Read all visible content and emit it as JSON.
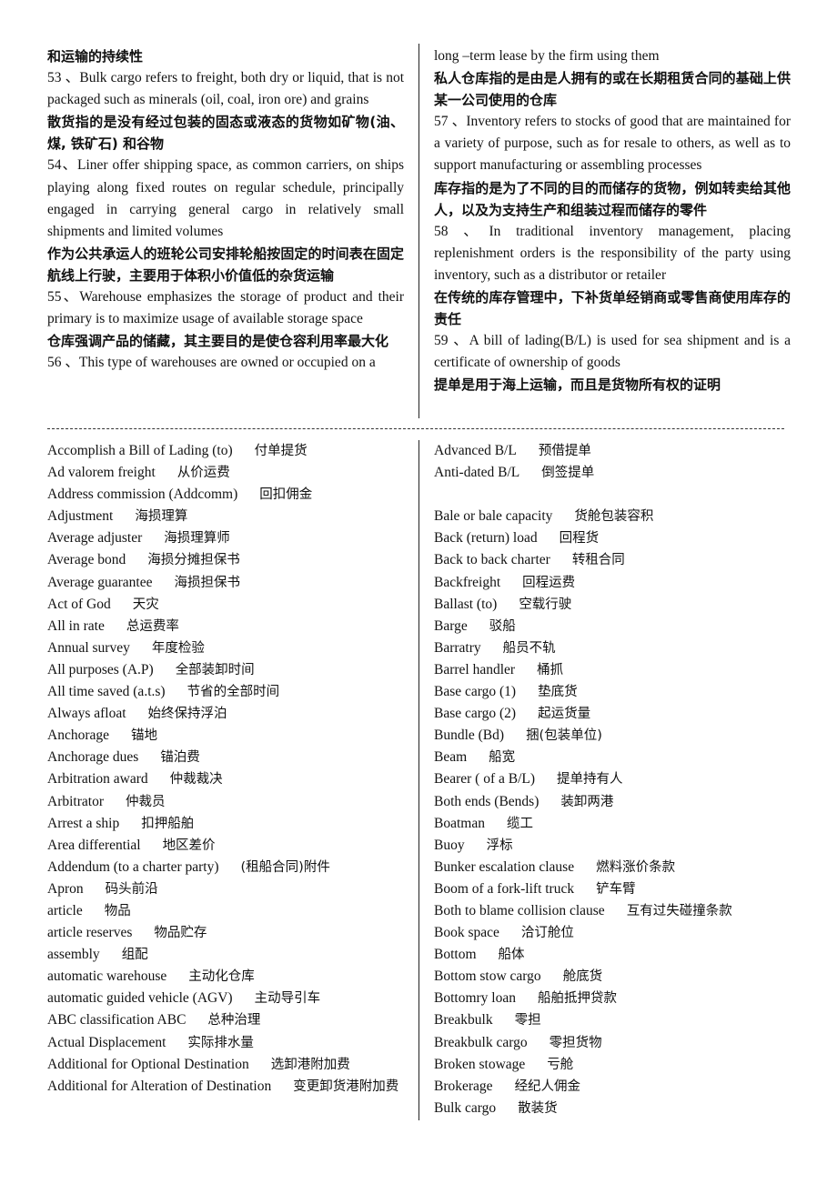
{
  "top_left": [
    {
      "lang": "cn",
      "text": "和运输的持续性"
    },
    {
      "lang": "en",
      "text": "53 、Bulk cargo refers to freight, both dry or liquid, that is not packaged such as minerals (oil, coal, iron ore) and grains"
    },
    {
      "lang": "cn",
      "text": "散货指的是没有经过包装的固态或液态的货物如矿物(油、煤, 铁矿石) 和谷物"
    },
    {
      "lang": "en",
      "text": "54、Liner offer shipping space, as common carriers, on ships playing along fixed routes on regular schedule, principally engaged in carrying general cargo in relatively small shipments and limited volumes"
    },
    {
      "lang": "cn",
      "text": "作为公共承运人的班轮公司安排轮船按固定的时间表在固定航线上行驶，主要用于体积小价值低的杂货运输"
    },
    {
      "lang": "en",
      "text": "55、Warehouse emphasizes the storage of product and their primary is to maximize usage of available storage space"
    },
    {
      "lang": "cn",
      "text": "仓库强调产品的储藏，其主要目的是使仓容利用率最大化"
    },
    {
      "lang": "en",
      "text": "56 、This type of warehouses are owned or occupied on a"
    }
  ],
  "top_right": [
    {
      "lang": "en",
      "text": "long –term lease by the firm using them"
    },
    {
      "lang": "cn",
      "text": "私人仓库指的是由是人拥有的或在长期租赁合同的基础上供某一公司使用的仓库"
    },
    {
      "lang": "en",
      "text": "57 、Inventory refers to stocks of good that are maintained for a variety of purpose, such as for resale to others, as well as to support manufacturing or assembling processes"
    },
    {
      "lang": "cn",
      "text": "库存指的是为了不同的目的而储存的货物，例如转卖给其他人，以及为支持生产和组装过程而储存的零件"
    },
    {
      "lang": "en",
      "text": "58 、In traditional inventory management, placing replenishment orders is the responsibility of the party using inventory, such as a distributor or retailer"
    },
    {
      "lang": "cn",
      "text": "在传统的库存管理中，下补货单经销商或零售商使用库存的责任"
    },
    {
      "lang": "en",
      "text": "59 、A bill of lading(B/L) is used for sea shipment and is a certificate of ownership of goods"
    },
    {
      "lang": "cn",
      "text": "提单是用于海上运输，而且是货物所有权的证明"
    }
  ],
  "glossary_left": [
    {
      "term": "Accomplish a Bill of Lading (to)",
      "zh": "付单提货"
    },
    {
      "term": "Ad valorem freight",
      "zh": "从价运费"
    },
    {
      "term": "Address commission (Addcomm)",
      "zh": "回扣佣金"
    },
    {
      "term": "Adjustment",
      "zh": "海损理算"
    },
    {
      "term": "Average adjuster",
      "zh": "海损理算师"
    },
    {
      "term": "Average bond",
      "zh": "海损分摊担保书"
    },
    {
      "term": "Average guarantee",
      "zh": "海损担保书"
    },
    {
      "term": "Act of God",
      "zh": "天灾"
    },
    {
      "term": "All in rate",
      "zh": "总运费率"
    },
    {
      "term": "Annual survey",
      "zh": "年度检验"
    },
    {
      "term": "All purposes (A.P)",
      "zh": "全部装卸时间"
    },
    {
      "term": "All time saved (a.t.s)",
      "zh": "节省的全部时间"
    },
    {
      "term": "Always afloat",
      "zh": "始终保持浮泊"
    },
    {
      "term": "Anchorage",
      "zh": "锚地"
    },
    {
      "term": "Anchorage dues",
      "zh": "锚泊费"
    },
    {
      "term": "Arbitration award",
      "zh": "仲裁裁决"
    },
    {
      "term": "Arbitrator",
      "zh": "仲裁员"
    },
    {
      "term": "Arrest a ship",
      "zh": "扣押船舶"
    },
    {
      "term": "Area differential",
      "zh": "地区差价"
    },
    {
      "term": "Addendum (to a charter party)",
      "zh": "(租船合同)附件"
    },
    {
      "term": "Apron",
      "zh": "码头前沿"
    },
    {
      "term": "article",
      "zh": "物品"
    },
    {
      "term": "article reserves",
      "zh": "物品贮存"
    },
    {
      "term": "assembly",
      "zh": "组配"
    },
    {
      "term": "automatic warehouse",
      "zh": "主动化仓库"
    },
    {
      "term": "automatic guided vehicle (AGV)",
      "zh": "主动导引车"
    },
    {
      "term": "ABC classification ABC",
      "zh": "总种治理"
    },
    {
      "term": "Actual Displacement",
      "zh": "实际排水量"
    },
    {
      "term": "Additional for Optional Destination",
      "zh": "选卸港附加费"
    },
    {
      "term": "Additional for Alteration of Destination",
      "zh": "变更卸货港附加费",
      "wrap": true
    }
  ],
  "glossary_right": [
    {
      "term": "Advanced B/L",
      "zh": "预借提单"
    },
    {
      "term": "Anti-dated B/L",
      "zh": "倒签提单"
    },
    {
      "term": "",
      "zh": ""
    },
    {
      "term": "Bale or bale capacity",
      "zh": "货舱包装容积"
    },
    {
      "term": "Back (return) load",
      "zh": "回程货"
    },
    {
      "term": "Back to back charter",
      "zh": "转租合同"
    },
    {
      "term": "Backfreight",
      "zh": "回程运费"
    },
    {
      "term": "Ballast (to)",
      "zh": "空载行驶"
    },
    {
      "term": "Barge",
      "zh": "驳船"
    },
    {
      "term": "Barratry",
      "zh": "船员不轨"
    },
    {
      "term": "Barrel handler",
      "zh": "桶抓"
    },
    {
      "term": "Base cargo (1)",
      "zh": "垫底货"
    },
    {
      "term": "Base cargo (2)",
      "zh": "起运货量"
    },
    {
      "term": "Bundle (Bd)",
      "zh": "捆(包装单位)"
    },
    {
      "term": "Beam",
      "zh": "船宽"
    },
    {
      "term": "Bearer ( of a B/L)",
      "zh": "提单持有人"
    },
    {
      "term": "Both ends (Bends)",
      "zh": "装卸两港"
    },
    {
      "term": "Boatman",
      "zh": "缆工"
    },
    {
      "term": "Buoy",
      "zh": "浮标"
    },
    {
      "term": "Bunker escalation clause",
      "zh": "燃料涨价条款"
    },
    {
      "term": "Boom of a fork-lift truck",
      "zh": "铲车臂"
    },
    {
      "term": "Both to blame collision clause",
      "zh": "互有过失碰撞条款"
    },
    {
      "term": "Book space",
      "zh": "洽订舱位"
    },
    {
      "term": "Bottom",
      "zh": "船体"
    },
    {
      "term": "Bottom stow cargo",
      "zh": "舱底货"
    },
    {
      "term": "Bottomry loan",
      "zh": "船舶抵押贷款"
    },
    {
      "term": "Breakbulk",
      "zh": "零担"
    },
    {
      "term": "Breakbulk cargo",
      "zh": "零担货物"
    },
    {
      "term": "Broken stowage",
      "zh": "亏舱"
    },
    {
      "term": "Brokerage",
      "zh": "经纪人佣金"
    },
    {
      "term": "Bulk cargo",
      "zh": "散装货"
    }
  ]
}
